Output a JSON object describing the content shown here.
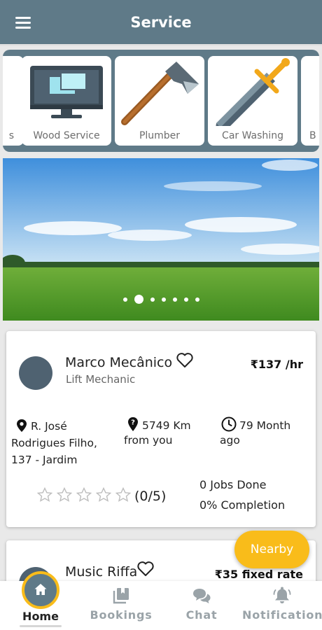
{
  "appbar": {
    "title": "Service",
    "menu_icon": "hamburger-menu-icon"
  },
  "categories": [
    {
      "label": "s",
      "icon": "partial-category-icon"
    },
    {
      "label": "Wood Service",
      "icon": "computer-monitor-icon"
    },
    {
      "label": "Plumber",
      "icon": "axe-icon"
    },
    {
      "label": "Car Washing",
      "icon": "sword-icon"
    },
    {
      "label": "B",
      "icon": "partial-category-icon"
    }
  ],
  "banner": {
    "slides_total": 7,
    "active_slide_index": 1
  },
  "providers": [
    {
      "name": "Marco Mecânico",
      "role": "Lift Mechanic",
      "price": "₹137 /hr",
      "address_lines": [
        "R. José",
        "Rodrigues Filho,",
        "137 - Jardim"
      ],
      "distance_lines": [
        "5749 Km",
        "from you"
      ],
      "experience_lines": [
        "79 Month",
        "ago"
      ],
      "rating_stars": 0,
      "rating_label": "(0/5)",
      "jobs_done": "0 Jobs Done",
      "completion": "0% Completion"
    },
    {
      "name": "Music Riffa",
      "price": "₹35 fixed rate"
    }
  ],
  "fab": {
    "label": "Nearby"
  },
  "bottom_nav": [
    {
      "label": "Home",
      "icon": "home-icon",
      "active": true
    },
    {
      "label": "Bookings",
      "icon": "bookings-icon"
    },
    {
      "label": "Chat",
      "icon": "chat-icon"
    },
    {
      "label": "Notifications",
      "icon": "bell-icon"
    }
  ],
  "colors": {
    "primary": "#5f7a88",
    "accent": "#f9bc1a",
    "avatar": "#4f6271",
    "nav_inactive": "#9aa3a8"
  }
}
